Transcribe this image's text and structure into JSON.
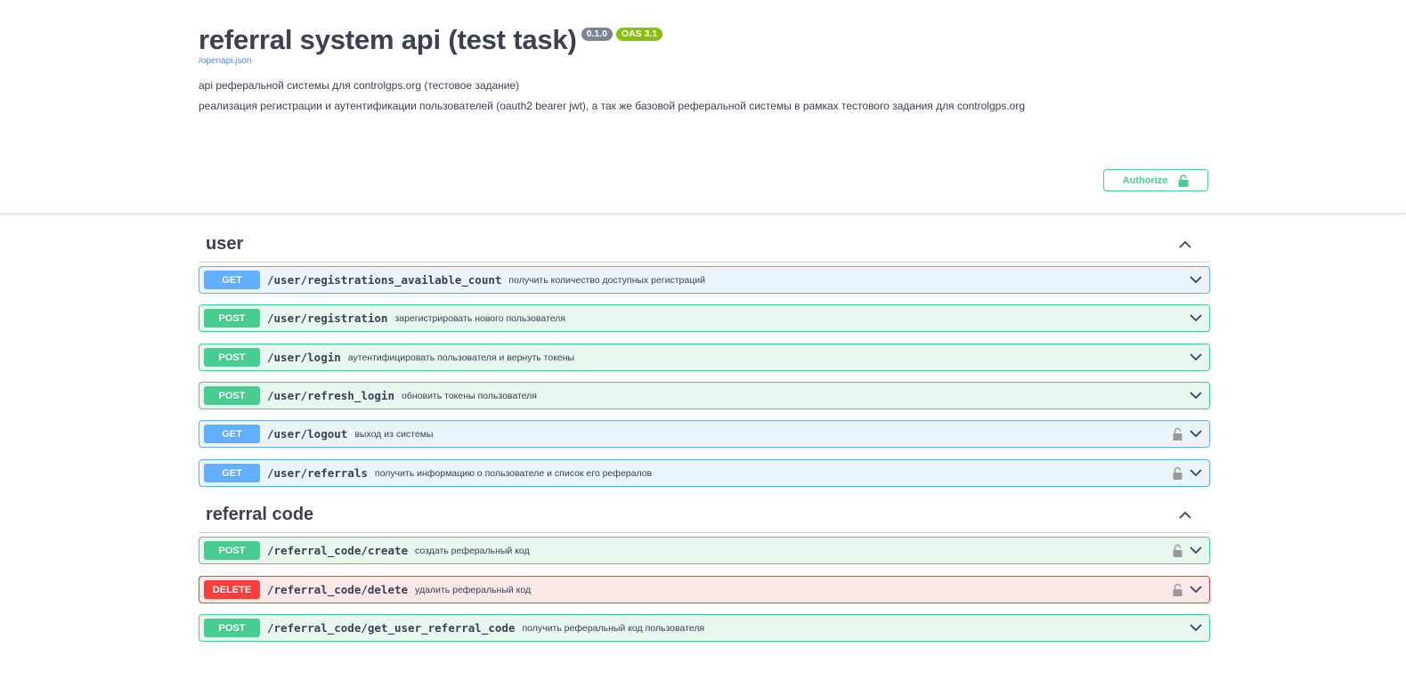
{
  "info": {
    "title": "referral system api (test task)",
    "version_badge": "0.1.0",
    "oas_badge": "OAS 3.1",
    "spec_link": "/openapi.json",
    "description_line1": "api реферальной системы для controlgps.org (тестовое задание)",
    "description_line2": "реализация регистрации и аутентификации пользователей (oauth2 bearer jwt), а так же базовой реферальной системы в рамках тестового задания для controlgps.org"
  },
  "authorize": {
    "label": "Authorize"
  },
  "colors": {
    "get": "#61affe",
    "post": "#49cc90",
    "delete": "#f93e3e",
    "get_bg": "#ebf3fb",
    "post_bg": "#e8f6f0",
    "delete_bg": "#fae7e7",
    "text": "#3b4151"
  },
  "sections": [
    {
      "name": "user",
      "operations": [
        {
          "method": "GET",
          "path": "/user/registrations_available_count",
          "summary": "получить количество доступных регистраций",
          "locked": false
        },
        {
          "method": "POST",
          "path": "/user/registration",
          "summary": "зарегистрировать нового пользователя",
          "locked": false
        },
        {
          "method": "POST",
          "path": "/user/login",
          "summary": "аутентифицировать пользователя и вернуть токены",
          "locked": false
        },
        {
          "method": "POST",
          "path": "/user/refresh_login",
          "summary": "обновить токены пользователя",
          "locked": false
        },
        {
          "method": "GET",
          "path": "/user/logout",
          "summary": "выход из системы",
          "locked": true
        },
        {
          "method": "GET",
          "path": "/user/referrals",
          "summary": "получить информацию о пользователе и список его рефералов",
          "locked": true
        }
      ]
    },
    {
      "name": "referral code",
      "operations": [
        {
          "method": "POST",
          "path": "/referral_code/create",
          "summary": "создать реферальный код",
          "locked": true
        },
        {
          "method": "DELETE",
          "path": "/referral_code/delete",
          "summary": "удалить реферальный код",
          "locked": true
        },
        {
          "method": "POST",
          "path": "/referral_code/get_user_referral_code",
          "summary": "получить реферальный код пользователя",
          "locked": false
        }
      ]
    }
  ]
}
